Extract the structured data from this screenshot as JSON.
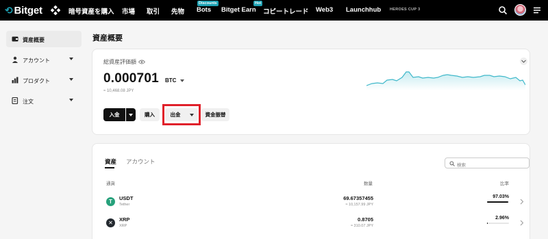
{
  "brand": {
    "name": "Bitget",
    "accent": "#1da2b4"
  },
  "nav": {
    "items": [
      {
        "label": "暗号資産を購入"
      },
      {
        "label": "市場"
      },
      {
        "label": "取引"
      },
      {
        "label": "先物"
      },
      {
        "label": "Bots",
        "badge": "Discounts"
      },
      {
        "label": "Bitget Earn",
        "badge": "Hot"
      },
      {
        "label": "コピートレード"
      },
      {
        "label": "Web3"
      },
      {
        "label": "Launchhub"
      }
    ],
    "heroes": "HEROES CUP 3"
  },
  "sidebar": {
    "items": [
      {
        "label": "資産概要",
        "icon": "wallet-icon",
        "active": true
      },
      {
        "label": "アカウント",
        "icon": "person-icon"
      },
      {
        "label": "プロダクト",
        "icon": "products-icon"
      },
      {
        "label": "注文",
        "icon": "orders-icon"
      }
    ]
  },
  "page": {
    "title": "資産概要"
  },
  "overview": {
    "label": "総資産評価額",
    "value": "0.000701",
    "unit": "BTC",
    "jpy": "≈ 10,468.08 JPY",
    "buttons": {
      "deposit": "入金",
      "buy": "購入",
      "withdraw": "出金",
      "transfer": "資金振替"
    },
    "highlight_color": "#e0202a"
  },
  "assets": {
    "tabs": [
      "資産",
      "アカウント"
    ],
    "search_placeholder": "検索",
    "columns": {
      "coin": "通貨",
      "qty": "数量",
      "ratio": "比率"
    },
    "rows": [
      {
        "symbol": "USDT",
        "name": "Tether",
        "qty": "69.67357455",
        "jpy": "≈ 10,157.99 JPY",
        "pct": "97.03%",
        "ratio": 0.9703,
        "color": "#26a17b"
      },
      {
        "symbol": "XRP",
        "name": "XRP",
        "qty": "0.8705",
        "jpy": "≈ 310.07 JPY",
        "pct": "2.96%",
        "ratio": 0.0296,
        "color": "#23292f"
      }
    ]
  }
}
